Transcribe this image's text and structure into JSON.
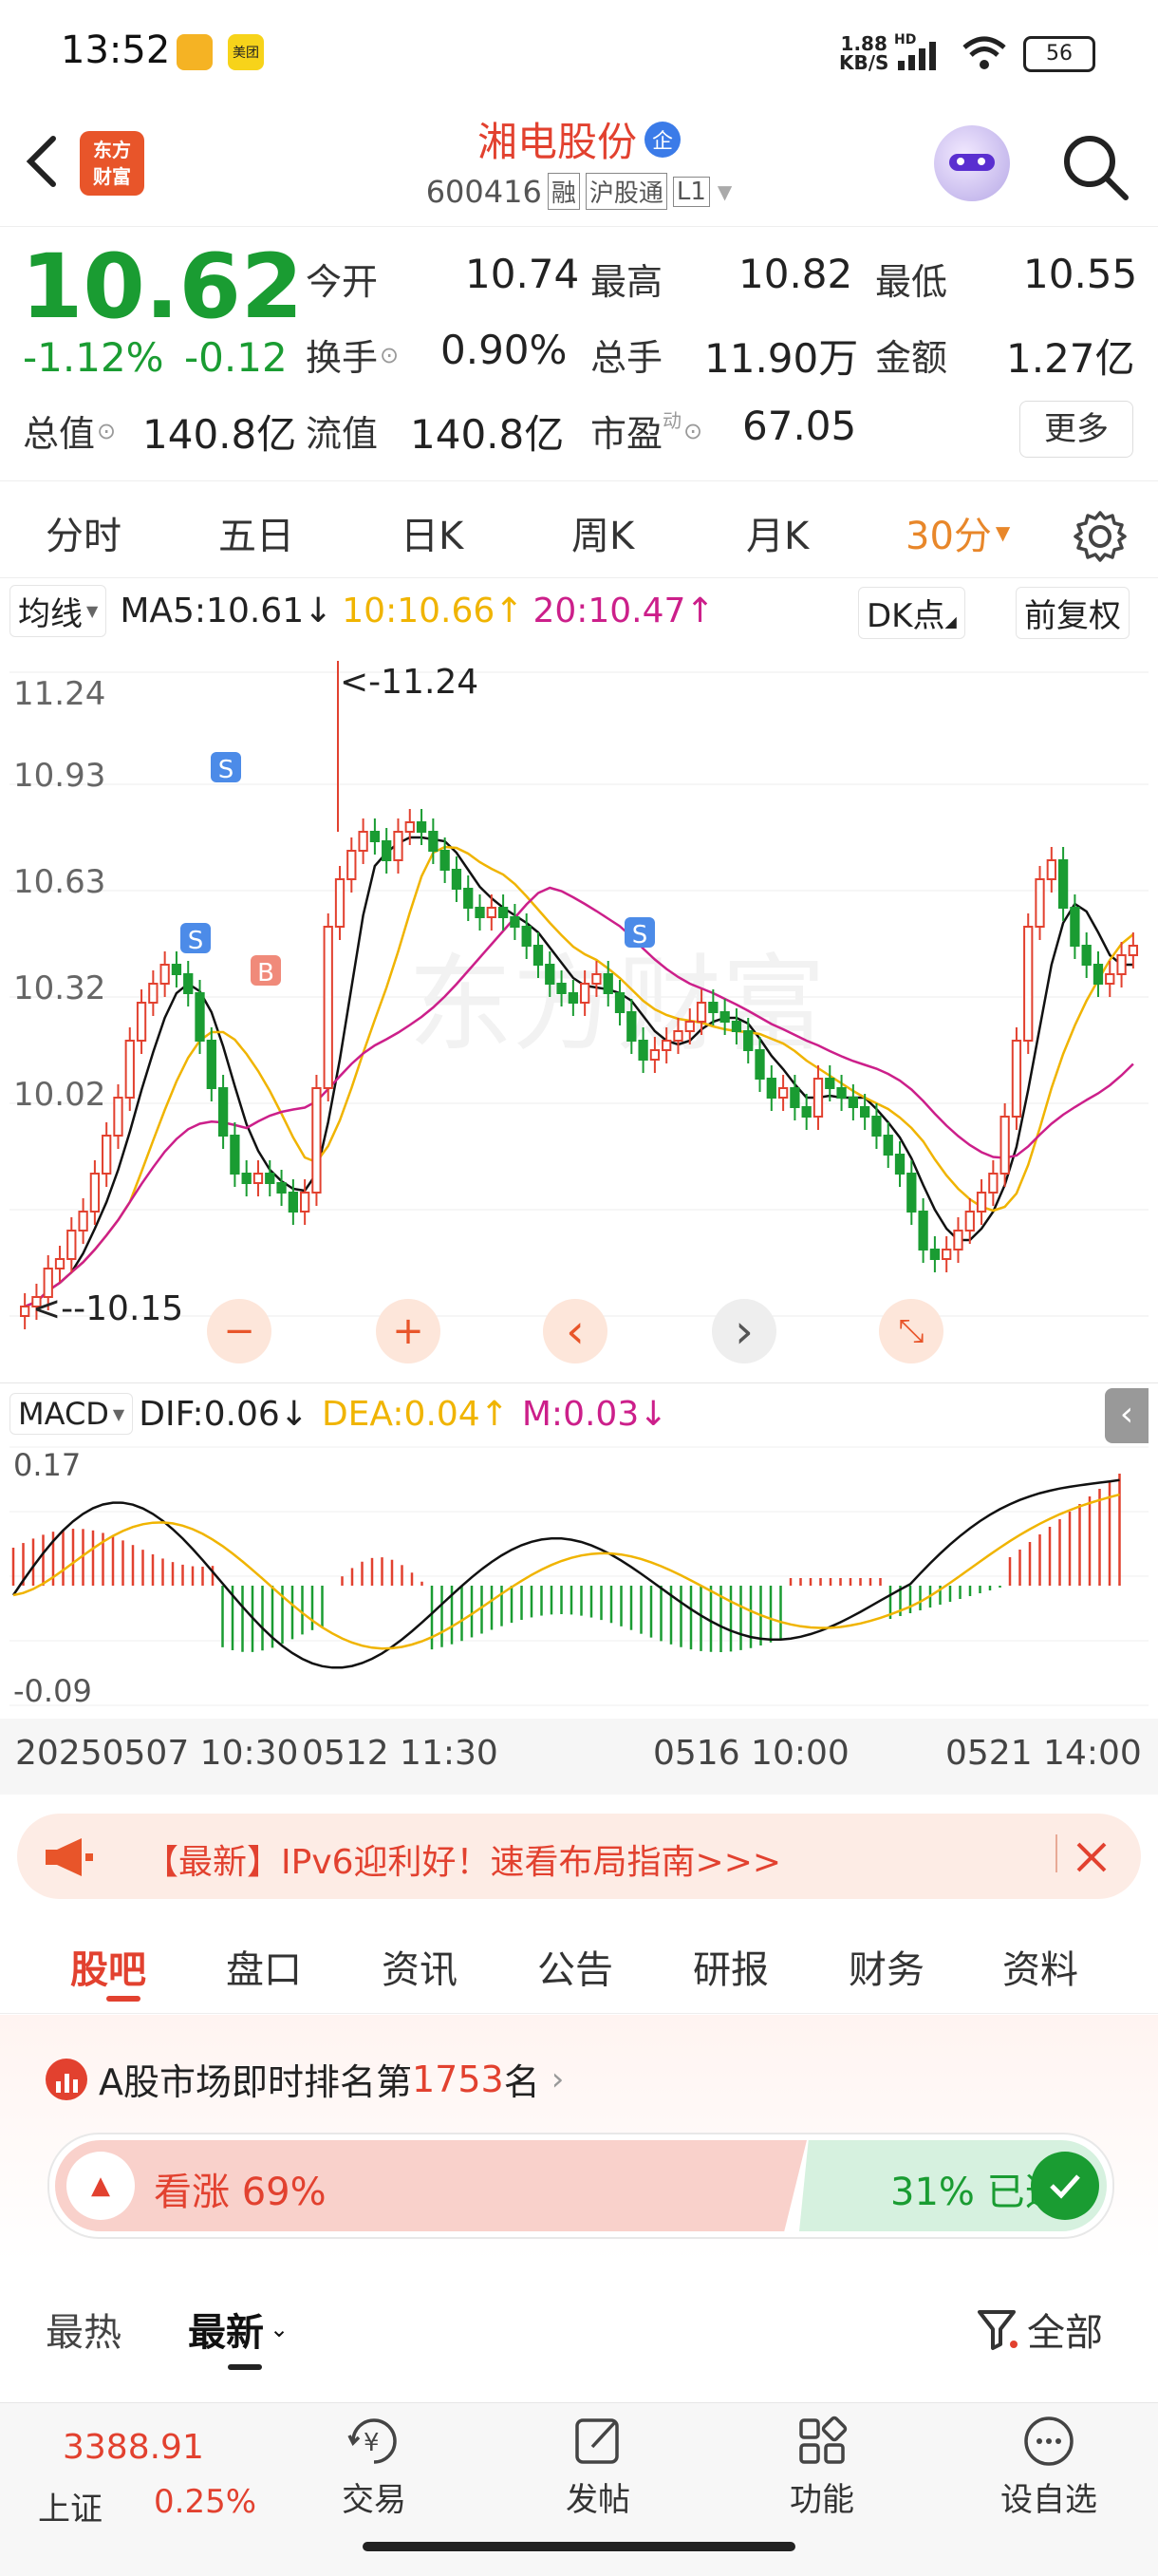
{
  "status_bar": {
    "time": "13:52",
    "app1": "",
    "app2": "美团",
    "net_speed": "1.88",
    "net_unit": "KB/S",
    "hd": "HD",
    "battery": "56"
  },
  "header": {
    "logo_line1": "东方",
    "logo_line2": "财富",
    "title": "湘电股份",
    "title_badge": "企",
    "code": "600416",
    "tag1": "融",
    "tag2": "沪股通",
    "tag3": "L1"
  },
  "quote": {
    "price": "10.62",
    "change_pct": "-1.12%",
    "change": "-0.12",
    "open_label": "今开",
    "open": "10.74",
    "high_label": "最高",
    "high": "10.82",
    "low_label": "最低",
    "low": "10.55",
    "turnover_label": "换手",
    "turnover": "0.90%",
    "volume_label": "总手",
    "volume": "11.90万",
    "amount_label": "金额",
    "amount": "1.27亿",
    "mcap_label": "总值",
    "mcap": "140.8亿",
    "float_label": "流值",
    "float_cap": "140.8亿",
    "pe_label": "市盈",
    "pe_sup": "动",
    "pe": "67.05",
    "more": "更多"
  },
  "period_tabs": [
    "分时",
    "五日",
    "日K",
    "周K",
    "月K"
  ],
  "period_active": "30分",
  "ma_bar": {
    "selector": "均线",
    "ma5": "MA5:10.61",
    "ma10": "10:10.66",
    "ma20": "20:10.47",
    "dk": "DK点",
    "fq": "前复权"
  },
  "chart_data": {
    "type": "candlestick",
    "y_ticks": [
      "11.24",
      "10.93",
      "10.63",
      "10.32",
      "10.02"
    ],
    "max_marker": "<-11.24",
    "min_marker": "<--10.15",
    "signals": [
      "S",
      "S",
      "B",
      "S"
    ],
    "macd": {
      "selector": "MACD",
      "dif": "DIF:0.06",
      "dea": "DEA:0.04",
      "m": "M:0.03",
      "y_top": "0.17",
      "y_bottom": "-0.09"
    },
    "x_labels": [
      "20250507 10:30",
      "0512 11:30",
      "0516 10:00",
      "0521 14:00"
    ],
    "colors": {
      "up": "#e2412f",
      "down": "#1a9c32",
      "ma5": "#111111",
      "ma10": "#f0b400",
      "ma20": "#cc1f8a"
    }
  },
  "chart_controls": {
    "minus": "−",
    "plus": "+",
    "prev": "‹",
    "next": "›"
  },
  "promo": {
    "text": "【最新】IPv6迎利好！速看布局指南>>>"
  },
  "section_tabs": [
    "股吧",
    "盘口",
    "资讯",
    "公告",
    "研报",
    "财务",
    "资料"
  ],
  "section_active": "股吧",
  "ranking": {
    "prefix": "A股市场即时排名第",
    "rank": "1753",
    "suffix": "名"
  },
  "vote": {
    "up_label": "看涨 69%",
    "down_label": "31% 已选",
    "up_ratio": 0.69
  },
  "feed_tabs": {
    "hot": "最热",
    "latest": "最新",
    "filter": "全部"
  },
  "bottom_nav": {
    "index_value": "3388.91",
    "index_name": "上证",
    "index_change": "0.25%",
    "trade": "交易",
    "post": "发帖",
    "func": "功能",
    "watch": "设自选"
  }
}
